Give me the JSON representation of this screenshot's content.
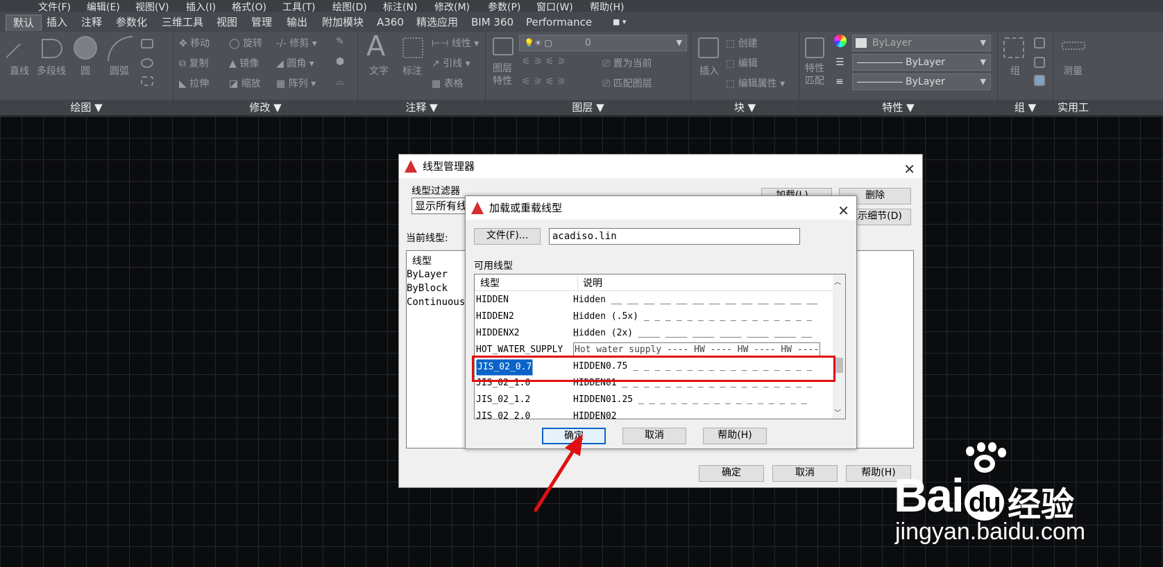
{
  "menu": [
    "文件(F)",
    "编辑(E)",
    "视图(V)",
    "插入(I)",
    "格式(O)",
    "工具(T)",
    "绘图(D)",
    "标注(N)",
    "修改(M)",
    "参数(P)",
    "窗口(W)",
    "帮助(H)"
  ],
  "tabs": [
    "默认",
    "插入",
    "注释",
    "参数化",
    "三维工具",
    "视图",
    "管理",
    "输出",
    "附加模块",
    "A360",
    "精选应用",
    "BIM 360",
    "Performance"
  ],
  "ribbon": {
    "draw": {
      "title": "绘图 ▼",
      "line": "直线",
      "polyline": "多段线",
      "circle": "圆",
      "arc": "圆弧"
    },
    "modify": {
      "title": "修改 ▼",
      "move": "移动",
      "rotate": "旋转",
      "trim": "修剪",
      "copy": "复制",
      "mirror": "镜像",
      "fillet": "圆角",
      "stretch": "拉伸",
      "scale": "缩放",
      "array": "阵列"
    },
    "annotation": {
      "title": "注释 ▼",
      "text": "文字",
      "dimension": "标注",
      "linear": "线性",
      "leader": "引线",
      "table": "表格"
    },
    "layers": {
      "title": "图层 ▼",
      "layer_props": "图层\n特性",
      "layer_value": "0",
      "set_current": "置为当前",
      "match_layer": "匹配图层"
    },
    "block": {
      "title": "块 ▼",
      "insert": "插入",
      "create": "创建",
      "edit": "编辑",
      "edit_attr": "编辑属性"
    },
    "properties": {
      "title": "特性 ▼",
      "match": "特性\n匹配",
      "color": "ByLayer",
      "linetype": "ByLayer",
      "lineweight": "ByLayer"
    },
    "group": {
      "title": "组 ▼",
      "group": "组"
    },
    "utilities": {
      "title": "实用工",
      "measure": "测量"
    }
  },
  "linetype_manager": {
    "title": "线型管理器",
    "filter_label": "线型过滤器",
    "filter_value": "显示所有线",
    "load_btn": "加载(L)...",
    "delete_btn": "删除",
    "details_btn": "显示细节(D)",
    "current_label": "当前线型:",
    "col_linetype": "线型",
    "items": [
      "ByLayer",
      "ByBlock",
      "Continuous"
    ],
    "ok": "确定",
    "cancel": "取消",
    "help": "帮助(H)"
  },
  "load_dialog": {
    "title": "加载或重载线型",
    "file_btn": "文件(F)...",
    "file_value": "acadiso.lin",
    "available_label": "可用线型",
    "col_linetype": "线型",
    "col_desc": "说明",
    "rows": [
      {
        "name": "HIDDEN",
        "desc": "Hidden __ __ __ __ __ __ __ __ __ __ __ __ __ _"
      },
      {
        "name": "HIDDEN2",
        "desc": "Hidden (.5x) _ _ _ _ _ _ _ _ _ _ _ _ _ _ _ _ _"
      },
      {
        "name": "HIDDENX2",
        "desc": "Hidden (2x) ____ ____ ____ ____ ____ ____ __"
      },
      {
        "name": "HOT_WATER_SUPPLY",
        "desc": "Hot water supply ---- HW ---- HW ---- HW ----"
      },
      {
        "name": "JIS_02_0.7",
        "desc": "HIDDEN0.75 _ _ _ _ _ _ _ _ _ _ _ _ _ _ _ _ _"
      },
      {
        "name": "JIS_02_1.0",
        "desc": "HIDDEN01 _ _ _ _ _ _ _ _ _ _ _ _ _ _ _ _ _ _"
      },
      {
        "name": "JIS_02_1.2",
        "desc": "HIDDEN01.25  _ _ _ _ _ _ _ _ _ _ _ _ _ _ _ _"
      },
      {
        "name": "JIS_02_2.0",
        "desc": "HIDDEN02"
      }
    ],
    "selected": "JIS_02_0.7",
    "ok": "确定",
    "cancel": "取消",
    "help": "帮助(H)"
  },
  "watermark": {
    "brand": "Bai",
    "du": "du",
    "cn": "经验",
    "url": "jingyan.baidu.com"
  },
  "colors": {
    "highlight": "#e01010",
    "selection": "#0a64c8"
  }
}
